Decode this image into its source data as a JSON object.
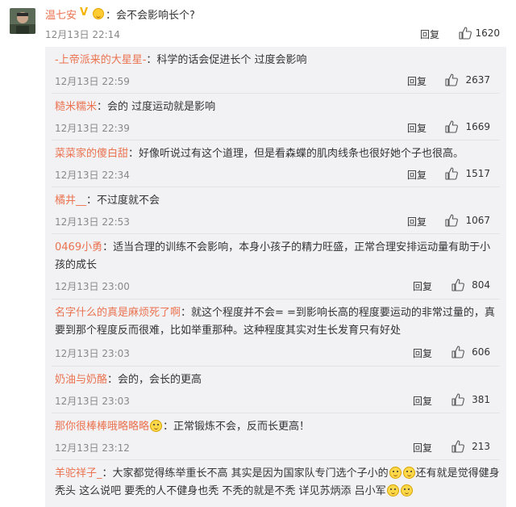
{
  "main_comment": {
    "username": "温七安",
    "badge": "V",
    "text": "：会不会影响长个?",
    "time": "12月13日 22:14",
    "reply_label": "回复",
    "likes": "1620"
  },
  "replies": [
    {
      "username": "-上帝派来的大星星-",
      "text": "：科学的话会促进长个 过度会影响",
      "time": "12月13日 22:59",
      "reply_label": "回复",
      "likes": "2637"
    },
    {
      "username": "糙米糯米",
      "text": "：会的  过度运动就是影响",
      "time": "12月13日 22:39",
      "reply_label": "回复",
      "likes": "1669"
    },
    {
      "username": "菜菜家的傻白甜",
      "text": "：好像听说过有这个道理，但是看森蝶的肌肉线条也很好她个子也很高。",
      "time": "12月13日 22:34",
      "reply_label": "回复",
      "likes": "1517"
    },
    {
      "username": "橘井__",
      "text": "：不过度就不会",
      "time": "12月13日 22:53",
      "reply_label": "回复",
      "likes": "1067"
    },
    {
      "username": "0469小勇",
      "text": "：适当合理的训练不会影响，本身小孩子的精力旺盛，正常合理安排运动量有助于小孩的成长",
      "time": "12月13日 23:00",
      "reply_label": "回复",
      "likes": "804"
    },
    {
      "username": "名字什么的真是麻烦死了啊",
      "text": "：就这个程度并不会= =到影响长高的程度要运动的非常过量的，真要到那个程度反而很难，比如举重那种。这种程度其实对生长发育只有好处",
      "time": "12月13日 23:03",
      "reply_label": "回复",
      "likes": "606"
    },
    {
      "username": "奶油与奶酪",
      "text": "：会的，会长的更高",
      "time": "12月13日 23:03",
      "reply_label": "回复",
      "likes": "381"
    },
    {
      "username": "那你很棒棒哦略略略",
      "text": "：正常锻炼不会，反而长更高！",
      "time": "12月13日 23:12",
      "reply_label": "回复",
      "likes": "213"
    },
    {
      "username": "羊驼祥子_",
      "text_a": "：大家都觉得练举重长不高 其实是因为国家队专门选个子小的",
      "text_b": "还有就是觉得健身秃头 这么说吧 要秃的人不健身也秃 不秃的就是不秃 详见苏炳添 吕小军",
      "time": "",
      "reply_label": "",
      "likes": ""
    }
  ],
  "colors": {
    "username": "#eb7350",
    "panel_bg": "#f2f2f5",
    "time": "#888888"
  },
  "icons": {
    "like": "thumbs-up-icon",
    "vip": "vip-badge-icon",
    "emoji": "emoji-face-icon"
  }
}
